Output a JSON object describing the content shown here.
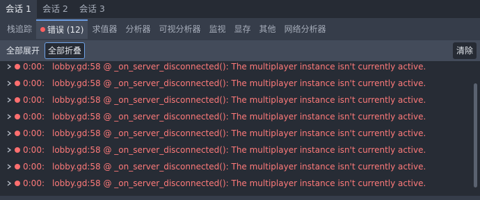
{
  "sessions": [
    {
      "label": "会话 1",
      "active": true
    },
    {
      "label": "会话 2",
      "active": false
    },
    {
      "label": "会话 3",
      "active": false
    }
  ],
  "debugger_tabs": [
    {
      "label": "栈追踪"
    },
    {
      "label": "错误 (12)",
      "active": true,
      "has_error_dot": true
    },
    {
      "label": "求值器"
    },
    {
      "label": "分析器"
    },
    {
      "label": "可视分析器"
    },
    {
      "label": "监视"
    },
    {
      "label": "显存"
    },
    {
      "label": "其他"
    },
    {
      "label": "网络分析器"
    }
  ],
  "toolbar": {
    "expand_all_label": "全部展开",
    "collapse_all_label": "全部折叠",
    "clear_label": "清除"
  },
  "errors": [
    {
      "time": "0:00:",
      "message": "lobby.gd:58 @ _on_server_disconnected(): The multiplayer instance isn't currently active."
    },
    {
      "time": "0:00:",
      "message": "lobby.gd:58 @ _on_server_disconnected(): The multiplayer instance isn't currently active."
    },
    {
      "time": "0:00:",
      "message": "lobby.gd:58 @ _on_server_disconnected(): The multiplayer instance isn't currently active."
    },
    {
      "time": "0:00:",
      "message": "lobby.gd:58 @ _on_server_disconnected(): The multiplayer instance isn't currently active."
    },
    {
      "time": "0:00:",
      "message": "lobby.gd:58 @ _on_server_disconnected(): The multiplayer instance isn't currently active."
    },
    {
      "time": "0:00:",
      "message": "lobby.gd:58 @ _on_server_disconnected(): The multiplayer instance isn't currently active."
    },
    {
      "time": "0:00:",
      "message": "lobby.gd:58 @ _on_server_disconnected(): The multiplayer instance isn't currently active."
    },
    {
      "time": "0:00:",
      "message": "lobby.gd:58 @ _on_server_disconnected(): The multiplayer instance isn't currently active."
    }
  ],
  "colors": {
    "error": "#ff7a7a",
    "accent": "#6fa3e8",
    "background": "#363d4a",
    "panel": "#272c35"
  }
}
